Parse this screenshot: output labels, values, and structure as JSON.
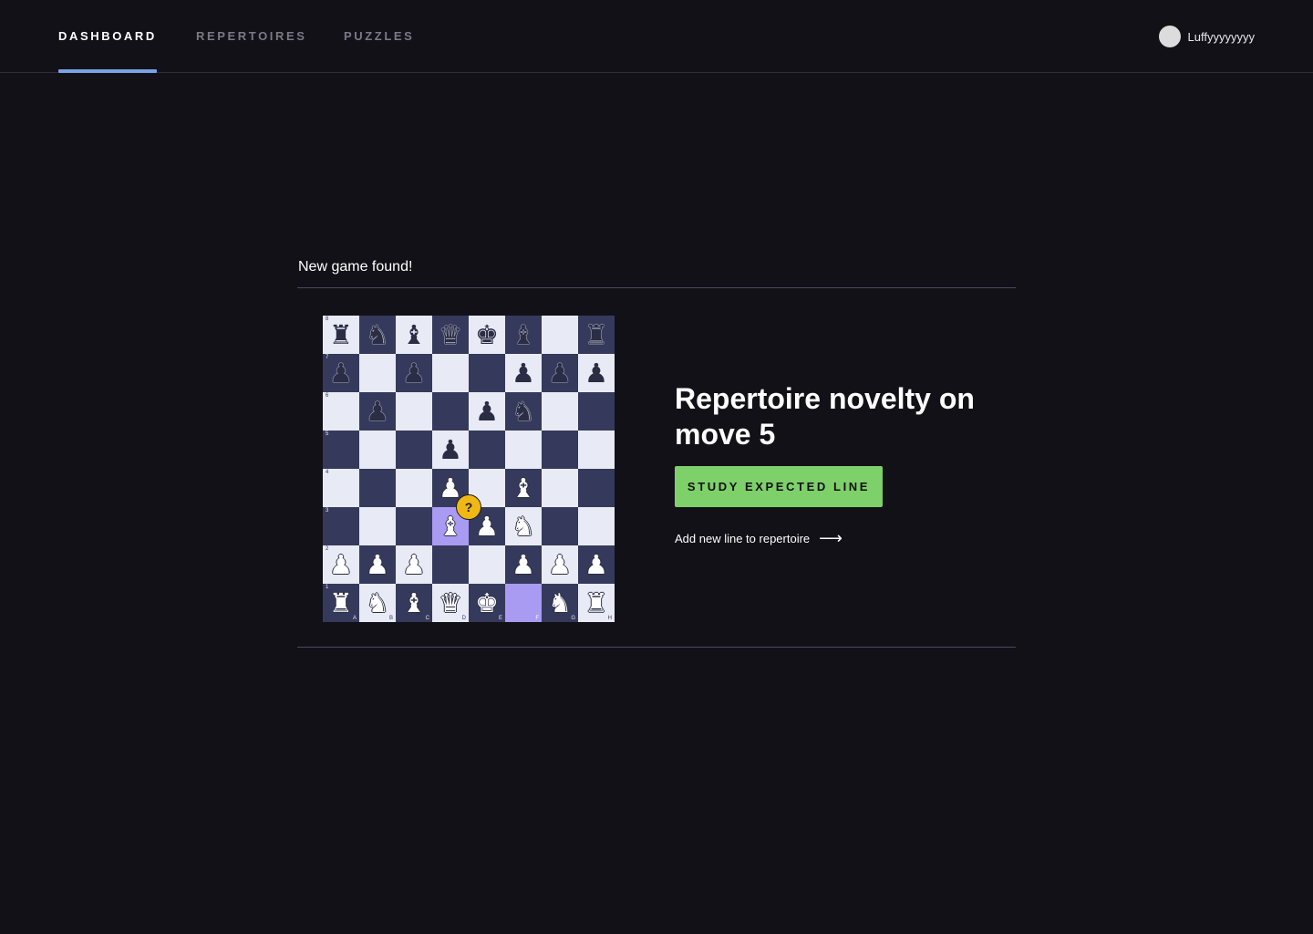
{
  "nav": {
    "tabs": [
      {
        "label": "DASHBOARD",
        "active": true
      },
      {
        "label": "REPERTOIRES",
        "active": false
      },
      {
        "label": "PUZZLES",
        "active": false
      }
    ],
    "user": {
      "name": "Luffyyyyyyyy"
    }
  },
  "main": {
    "section_title": "New game found!",
    "headline": "Repertoire novelty on move 5",
    "study_button": "STUDY EXPECTED LINE",
    "add_line_link": "Add new line to repertoire",
    "badge": "?",
    "board": {
      "ranks": [
        [
          "br",
          "bn",
          "bb",
          "bq",
          "bk",
          "bb",
          "",
          "br"
        ],
        [
          "bp",
          "",
          "bp",
          "",
          "",
          "bp",
          "bp",
          "bp"
        ],
        [
          "",
          "bp",
          "",
          "",
          "bp",
          "bn",
          "",
          ""
        ],
        [
          "",
          "",
          "",
          "bp",
          "",
          "",
          "",
          ""
        ],
        [
          "",
          "",
          "",
          "wp",
          "",
          "wb",
          "",
          ""
        ],
        [
          "",
          "",
          "",
          "wb",
          "wp",
          "wn",
          "",
          ""
        ],
        [
          "wp",
          "wp",
          "wp",
          "",
          "",
          "wp",
          "wp",
          "wp"
        ],
        [
          "wr",
          "wn",
          "wb",
          "wq",
          "wk",
          "",
          "wn",
          "wr"
        ]
      ],
      "rank_labels": [
        "8",
        "7",
        "6",
        "5",
        "4",
        "3",
        "2",
        "1"
      ],
      "file_labels": [
        "A",
        "B",
        "C",
        "D",
        "E",
        "F",
        "G",
        "H"
      ],
      "highlighted_squares": [
        "d3",
        "f1"
      ]
    },
    "colors": {
      "background": "#121117",
      "light_square": "#e8eaf6",
      "dark_square": "#353a5c",
      "highlight": "#a99af2",
      "button": "#7ed06b",
      "badge": "#f0b814",
      "active_tab_underline": "#7aa2e6"
    }
  }
}
